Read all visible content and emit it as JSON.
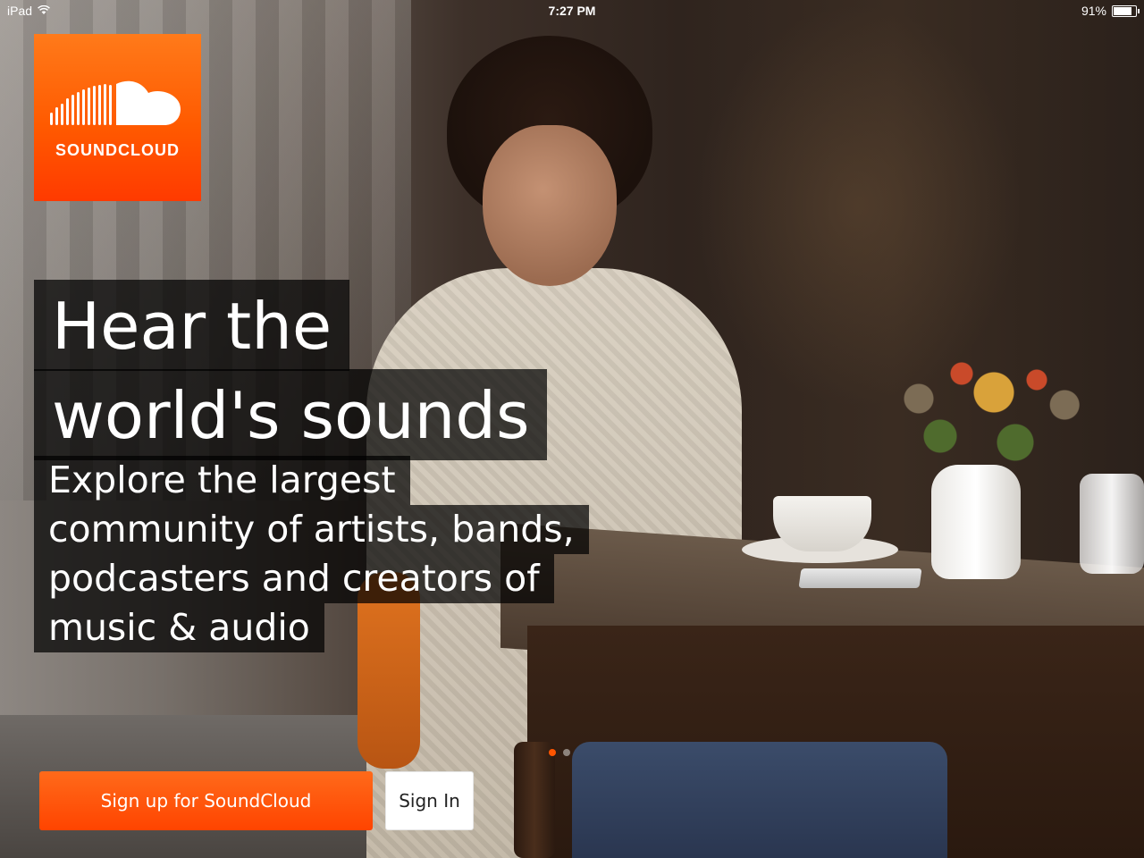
{
  "status_bar": {
    "device": "iPad",
    "time": "7:27 PM",
    "battery": "91%",
    "battery_level": 0.91,
    "wifi_icon": "wifi-icon"
  },
  "logo": {
    "text": "SOUNDCLOUD",
    "icon": "soundcloud-cloud-icon",
    "color": "#ff5500"
  },
  "headline": {
    "line1": "Hear the",
    "line2": "world's sounds"
  },
  "subhead": {
    "line1": "Explore the largest",
    "line2": "community of artists, bands,",
    "line3": "podcasters and creators of",
    "line4": "music & audio"
  },
  "carousel": {
    "page_count": 2,
    "current_page": 1
  },
  "actions": {
    "signup_label": "Sign up for SoundCloud",
    "signin_label": "Sign In"
  },
  "colors": {
    "accent": "#ff5500",
    "text_on_dark": "#ffffff",
    "overlay": "#000000"
  }
}
